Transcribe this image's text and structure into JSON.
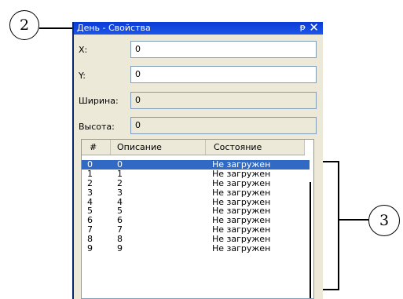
{
  "callouts": {
    "left": "2",
    "right": "3"
  },
  "window": {
    "title": "День - Свойства",
    "pin_glyph": "ᵽ",
    "close_glyph": "✕"
  },
  "fields": [
    {
      "label": "X:",
      "value": "0"
    },
    {
      "label": "Y:",
      "value": "0"
    },
    {
      "label": "Ширина:",
      "value": "0"
    },
    {
      "label": "Высота:",
      "value": "0"
    }
  ],
  "list": {
    "headers": [
      "#",
      "Описание",
      "Состояние"
    ],
    "rows": [
      {
        "num": "0",
        "desc": "0",
        "state": "Не загружен"
      },
      {
        "num": "1",
        "desc": "1",
        "state": "Не загружен"
      },
      {
        "num": "2",
        "desc": "2",
        "state": "Не загружен"
      },
      {
        "num": "3",
        "desc": "3",
        "state": "Не загружен"
      },
      {
        "num": "4",
        "desc": "4",
        "state": "Не загружен"
      },
      {
        "num": "5",
        "desc": "5",
        "state": "Не загружен"
      },
      {
        "num": "6",
        "desc": "6",
        "state": "Не загружен"
      },
      {
        "num": "7",
        "desc": "7",
        "state": "Не загружен"
      },
      {
        "num": "8",
        "desc": "8",
        "state": "Не загружен"
      },
      {
        "num": "9",
        "desc": "9",
        "state": "Не загружен"
      }
    ]
  }
}
